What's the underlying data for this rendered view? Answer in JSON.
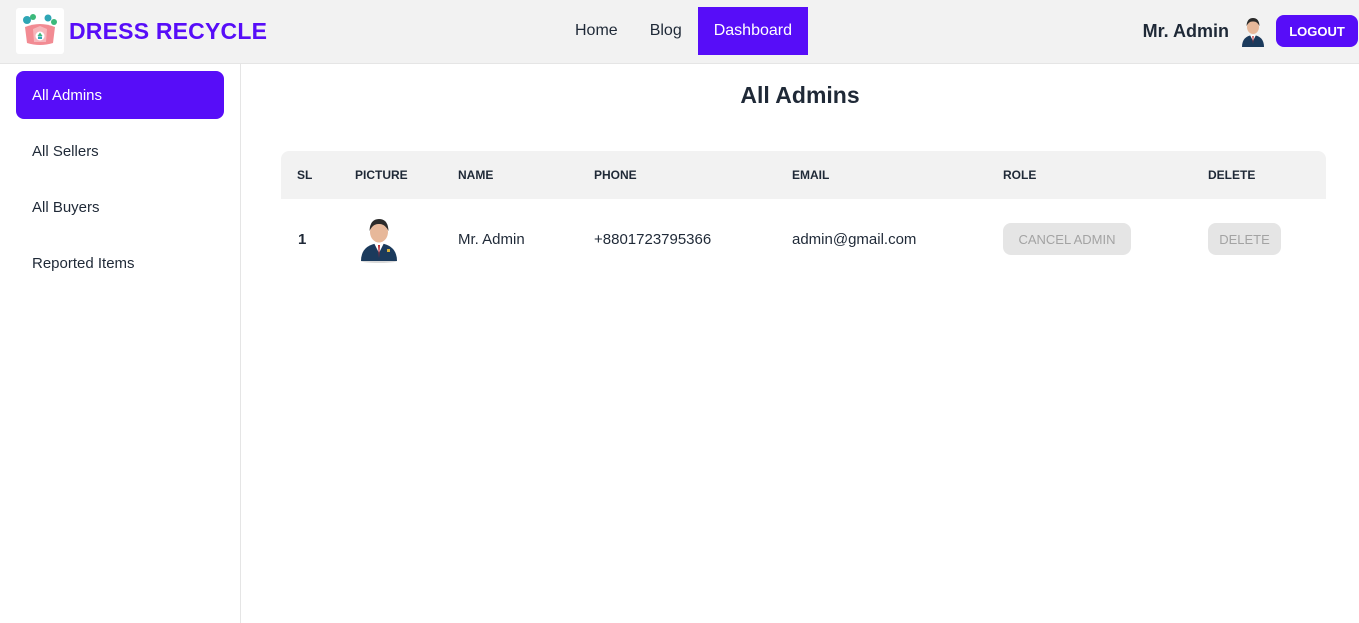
{
  "brand": {
    "name": "DRESS RECYCLE",
    "logo_icon": "recycle-logo-icon",
    "color": "#570df8"
  },
  "nav": {
    "items": [
      {
        "label": "Home",
        "active": false
      },
      {
        "label": "Blog",
        "active": false
      },
      {
        "label": "Dashboard",
        "active": true
      }
    ]
  },
  "user": {
    "name": "Mr. Admin",
    "avatar_icon": "admin-avatar-icon",
    "logout_label": "LOGOUT"
  },
  "sidebar": {
    "items": [
      {
        "label": "All Admins",
        "active": true
      },
      {
        "label": "All Sellers",
        "active": false
      },
      {
        "label": "All Buyers",
        "active": false
      },
      {
        "label": "Reported Items",
        "active": false
      }
    ]
  },
  "main": {
    "title": "All Admins",
    "table": {
      "headers": [
        "SL",
        "PICTURE",
        "NAME",
        "PHONE",
        "EMAIL",
        "ROLE",
        "DELETE"
      ],
      "rows": [
        {
          "sl": "1",
          "picture_icon": "admin-avatar-icon",
          "name": "Mr. Admin",
          "phone": "+8801723795366",
          "email": "admin@gmail.com",
          "role_button": "CANCEL ADMIN",
          "delete_button": "DELETE"
        }
      ]
    }
  },
  "colors": {
    "accent": "#570df8",
    "header_bg": "#f2f2f2",
    "disabled_bg": "#e5e5e5",
    "disabled_text": "#a3a3a3"
  }
}
